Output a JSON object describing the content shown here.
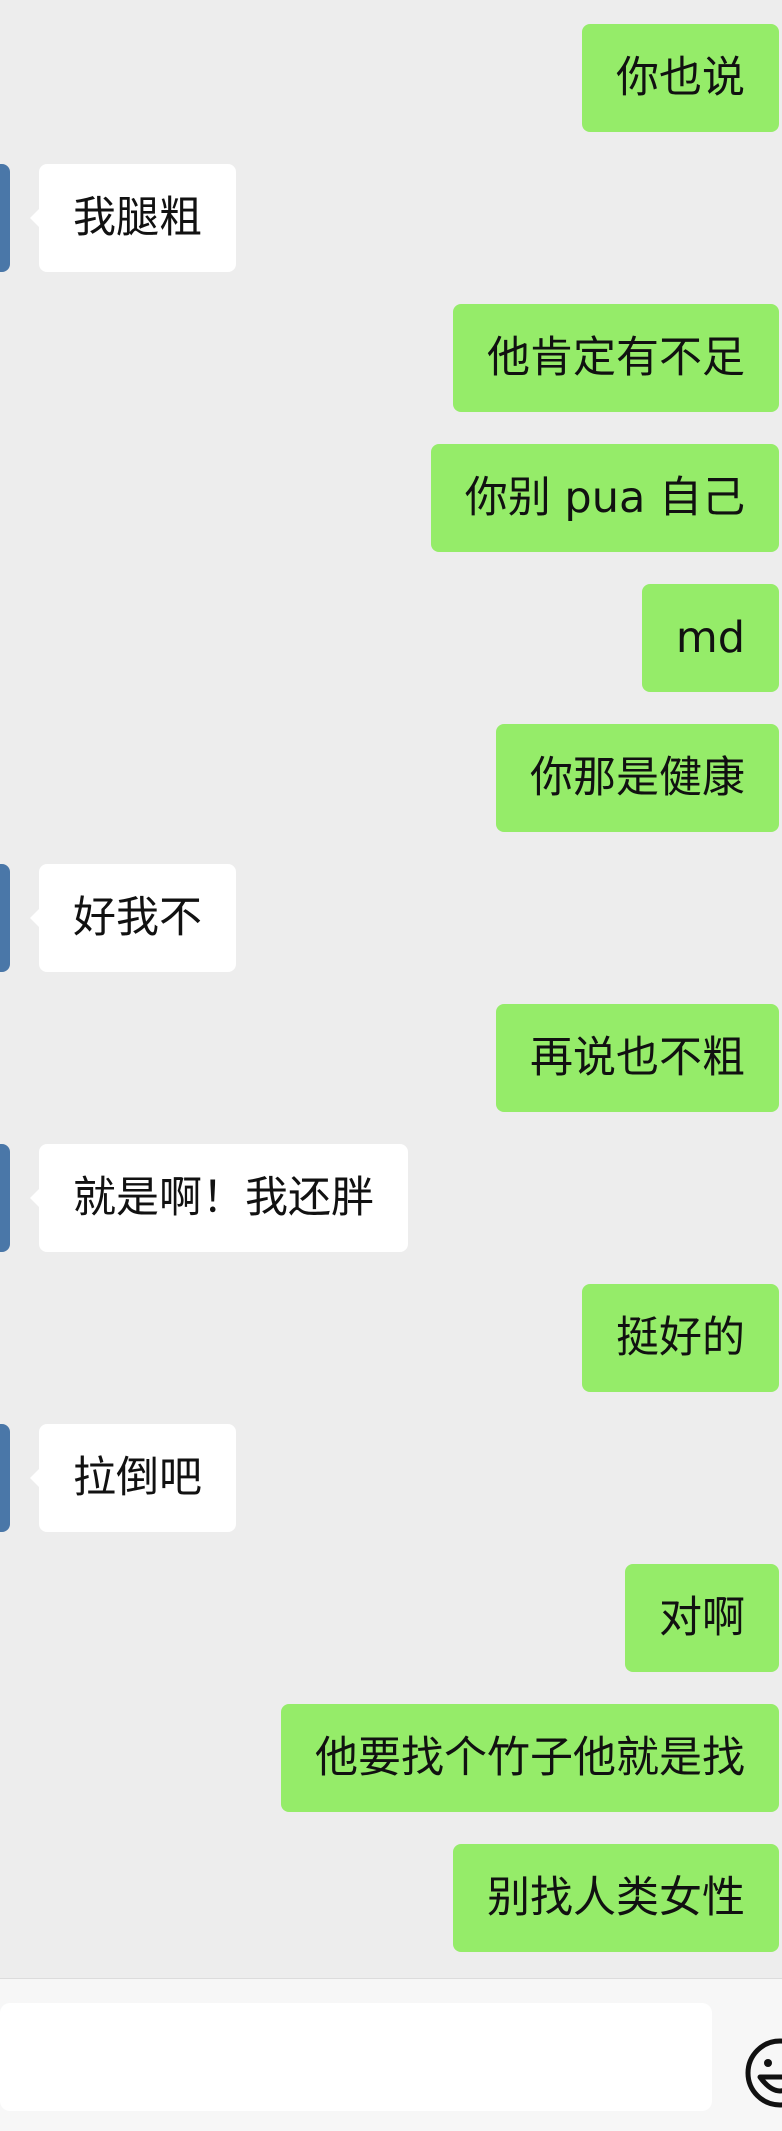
{
  "messages": [
    {
      "side": "out",
      "text": "你也说"
    },
    {
      "side": "in",
      "text": "我腿粗"
    },
    {
      "side": "out",
      "text": "他肯定有不足"
    },
    {
      "side": "out",
      "text": "你别 pua 自己"
    },
    {
      "side": "out",
      "text": "md"
    },
    {
      "side": "out",
      "text": "你那是健康"
    },
    {
      "side": "in",
      "text": "好我不"
    },
    {
      "side": "out",
      "text": "再说也不粗"
    },
    {
      "side": "in",
      "text": "就是啊！我还胖"
    },
    {
      "side": "out",
      "text": "挺好的"
    },
    {
      "side": "in",
      "text": "拉倒吧"
    },
    {
      "side": "out",
      "text": "对啊"
    },
    {
      "side": "out",
      "text": "他要找个竹子他就是找"
    },
    {
      "side": "out",
      "text": "别找人类女性"
    }
  ],
  "input_bar": {
    "value": "",
    "emoji_icon": "emoji-icon"
  },
  "colors": {
    "background": "#ededed",
    "outgoing_bubble": "#95ec69",
    "incoming_bubble": "#ffffff",
    "avatar": "#4a77a8"
  }
}
